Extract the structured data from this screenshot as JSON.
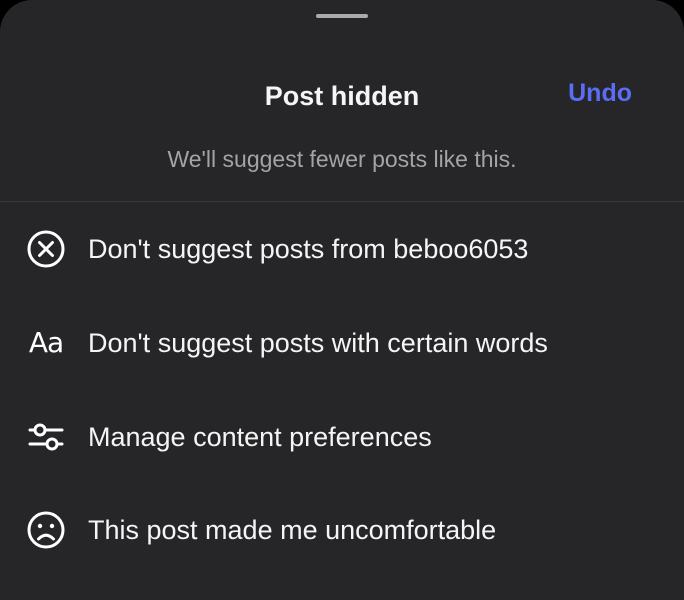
{
  "header": {
    "title": "Post hidden",
    "undo_label": "Undo",
    "subtitle": "We'll suggest fewer posts like this."
  },
  "options": [
    {
      "icon": "circle-x-icon",
      "label": "Don't suggest posts from beboo6053"
    },
    {
      "icon": "text-aa-icon",
      "icon_text": "Aa",
      "label": "Don't suggest posts with certain words"
    },
    {
      "icon": "sliders-icon",
      "label": "Manage content preferences"
    },
    {
      "icon": "sad-face-icon",
      "label": "This post made me uncomfortable"
    }
  ],
  "colors": {
    "sheet_background": "#262629",
    "accent": "#5b6cf5",
    "primary_text": "#f5f5f5",
    "secondary_text": "#a3a3a8"
  }
}
